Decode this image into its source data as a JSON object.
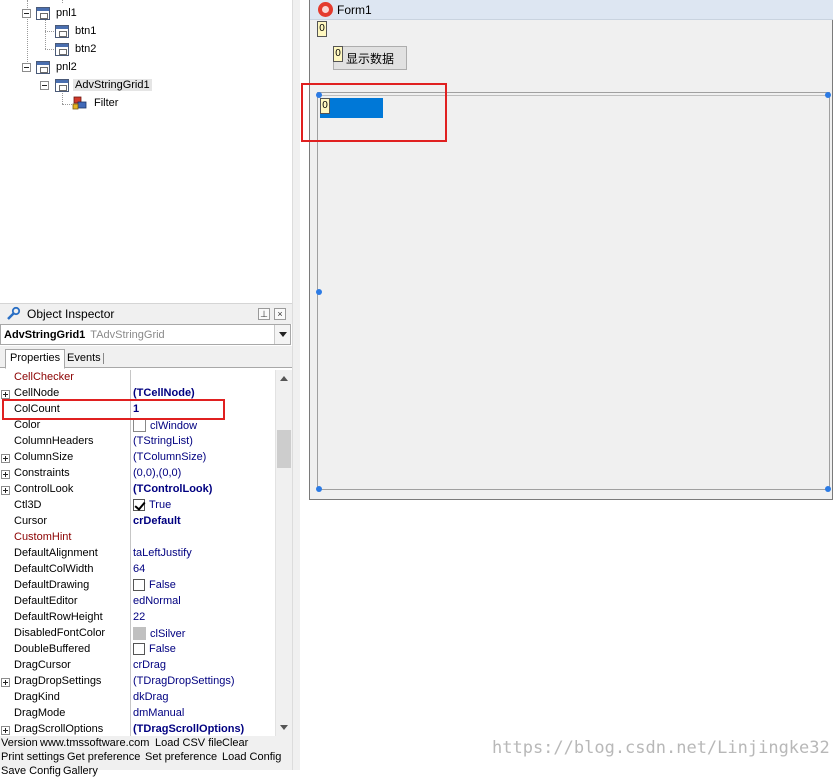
{
  "tree": {
    "nodes": [
      {
        "label": "pnl1"
      },
      {
        "label": "btn1"
      },
      {
        "label": "btn2"
      },
      {
        "label": "pnl2"
      },
      {
        "label": "AdvStringGrid1"
      },
      {
        "label": "Filter"
      }
    ]
  },
  "inspector": {
    "title": "Object Inspector",
    "component_name": "AdvStringGrid1",
    "component_type": "TAdvStringGrid",
    "tabs": [
      {
        "label": "Properties"
      },
      {
        "label": "Events"
      }
    ],
    "properties": [
      {
        "name": "CellChecker",
        "value": ""
      },
      {
        "name": "CellNode",
        "value": "(TCellNode)"
      },
      {
        "name": "ColCount",
        "value": "1"
      },
      {
        "name": "Color",
        "value": "clWindow"
      },
      {
        "name": "ColumnHeaders",
        "value": "(TStringList)"
      },
      {
        "name": "ColumnSize",
        "value": "(TColumnSize)"
      },
      {
        "name": "Constraints",
        "value": "(0,0),(0,0)"
      },
      {
        "name": "ControlLook",
        "value": "(TControlLook)"
      },
      {
        "name": "Ctl3D",
        "value": "True"
      },
      {
        "name": "Cursor",
        "value": "crDefault"
      },
      {
        "name": "CustomHint",
        "value": ""
      },
      {
        "name": "DefaultAlignment",
        "value": "taLeftJustify"
      },
      {
        "name": "DefaultColWidth",
        "value": "64"
      },
      {
        "name": "DefaultDrawing",
        "value": "False"
      },
      {
        "name": "DefaultEditor",
        "value": "edNormal"
      },
      {
        "name": "DefaultRowHeight",
        "value": "22"
      },
      {
        "name": "DisabledFontColor",
        "value": "clSilver"
      },
      {
        "name": "DoubleBuffered",
        "value": "False"
      },
      {
        "name": "DragCursor",
        "value": "crDrag"
      },
      {
        "name": "DragDropSettings",
        "value": "(TDragDropSettings)"
      },
      {
        "name": "DragKind",
        "value": "dkDrag"
      },
      {
        "name": "DragMode",
        "value": "dmManual"
      },
      {
        "name": "DragScrollOptions",
        "value": "(TDragScrollOptions)"
      }
    ],
    "links": {
      "version": "Version",
      "site": "www.tmssoftware.com",
      "load_csv": "Load CSV file",
      "clear": "Clear",
      "print": "Print settings",
      "get_pref": "Get preference",
      "set_pref": "Set preference",
      "load_config": "Load Config",
      "save_config": "Save Config",
      "gallery": "Gallery"
    }
  },
  "form": {
    "title": "Form1",
    "label_zero": "0",
    "button_zero": "0",
    "button_label": "显示数据",
    "grid_zero": "0"
  },
  "colors": {
    "highlight": "#e02020",
    "selection": "#0078d7"
  },
  "watermark": "https://blog.csdn.net/Linjingke32"
}
